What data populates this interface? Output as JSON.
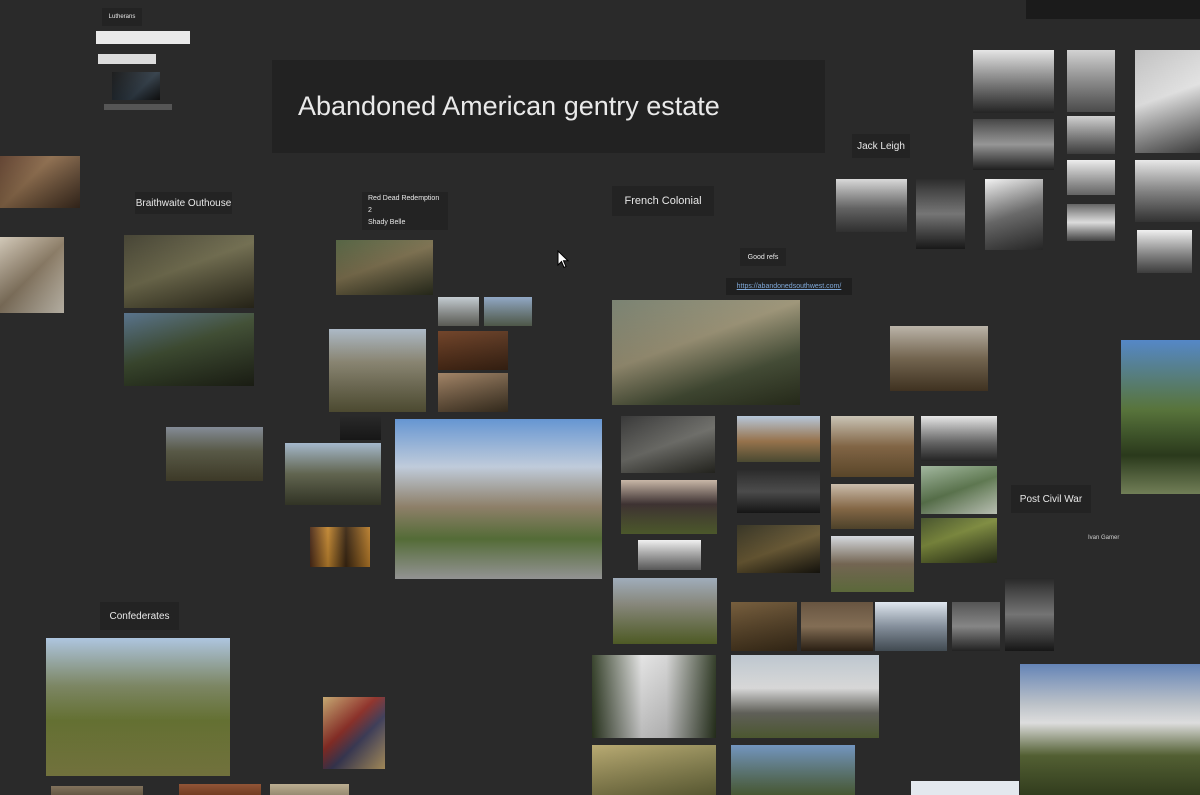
{
  "board": {
    "title": "Abandoned American gentry estate",
    "labels": {
      "top_left": "Lutherans",
      "braithwaite": "Braithwaite Outhouse",
      "red_dead": "Red Dead Redemption 2\nShady Belle",
      "french_colonial": "French Colonial",
      "jack_leigh": "Jack Leigh",
      "good_refs": "Good refs",
      "post_civil_war": "Post Civil War",
      "confederates": "Confederates",
      "tiny_note": "Ivan Gamer"
    },
    "link_text": "https://abandonedsouthwest.com/"
  },
  "colors": {
    "canvas": "#2a2a2a",
    "card": "#232323",
    "link": "#7fa8d8"
  },
  "icons": {
    "cursor": "mouse-pointer-icon"
  }
}
